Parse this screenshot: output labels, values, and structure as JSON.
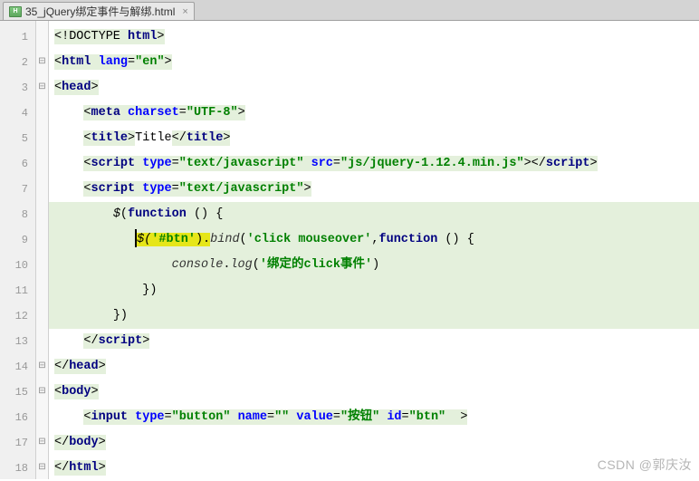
{
  "tab": {
    "filename": "35_jQuery绑定事件与解绑.html"
  },
  "gutter": [
    "1",
    "2",
    "3",
    "4",
    "5",
    "6",
    "7",
    "8",
    "9",
    "10",
    "11",
    "12",
    "13",
    "14",
    "15",
    "16",
    "17",
    "18"
  ],
  "code": {
    "l1": {
      "pre": "<!DOCTYPE ",
      "kw": "html",
      "post": ">"
    },
    "l2": {
      "open": "<",
      "tag": "html ",
      "attr": "lang",
      "eq": "=",
      "val": "\"en\"",
      "close": ">"
    },
    "l3": {
      "open": "<",
      "tag": "head",
      "close": ">"
    },
    "l4": {
      "open": "<",
      "tag": "meta ",
      "attr": "charset",
      "eq": "=",
      "val": "\"UTF-8\"",
      "close": ">"
    },
    "l5": {
      "open": "<",
      "tag": "title",
      "close": ">",
      "text": "Title",
      "open2": "</",
      "tag2": "title",
      "close2": ">"
    },
    "l6": {
      "open": "<",
      "tag": "script ",
      "a1": "type",
      "v1": "\"text/javascript\"",
      "a2": "src",
      "v2": "\"js/jquery-1.12.4.min.js\"",
      "close": ">",
      "open2": "</",
      "tag2": "script",
      "close2": ">"
    },
    "l7": {
      "open": "<",
      "tag": "script ",
      "a1": "type",
      "v1": "\"text/javascript\"",
      "close": ">"
    },
    "l8": {
      "dollar": "$",
      "paren": "(",
      "fn": "function ",
      "rest": "() {"
    },
    "l9": {
      "hl_open": "$(",
      "hl_str": "'#btn'",
      "hl_close": ").",
      "bind": "bind",
      "p1": "(",
      "arg1": "'click mouseover'",
      "comma": ",",
      "fn": "function ",
      "p2": "() {"
    },
    "l10": {
      "obj": "console",
      "dot": ".",
      "m": "log",
      "p1": "(",
      "arg": "'绑定的click事件'",
      "p2": ")"
    },
    "l11": {
      "text": "})"
    },
    "l12": {
      "text": "})"
    },
    "l13": {
      "open": "</",
      "tag": "script",
      "close": ">"
    },
    "l14": {
      "open": "</",
      "tag": "head",
      "close": ">"
    },
    "l15": {
      "open": "<",
      "tag": "body",
      "close": ">"
    },
    "l16": {
      "open": "<",
      "tag": "input ",
      "a1": "type",
      "v1": "\"button\"",
      "a2": "name",
      "v2": "\"\"",
      "a3": "value",
      "v3": "\"按钮\"",
      "a4": "id",
      "v4": "\"btn\"",
      "close": "  >"
    },
    "l17": {
      "open": "</",
      "tag": "body",
      "close": ">"
    },
    "l18": {
      "open": "</",
      "tag": "html",
      "close": ">"
    }
  },
  "watermark": "CSDN @郭庆汝"
}
